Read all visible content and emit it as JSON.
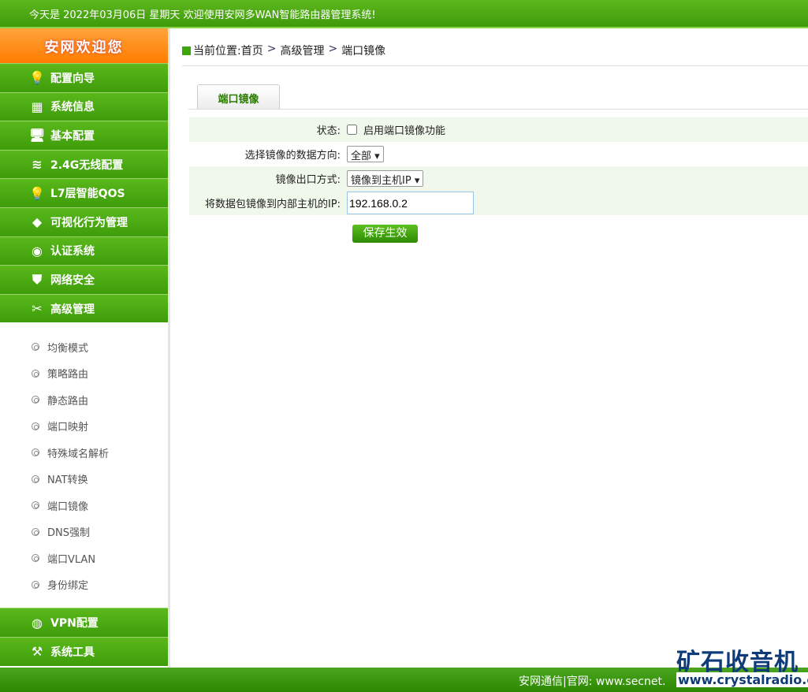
{
  "header": {
    "text": "今天是 2022年03月06日 星期天 欢迎使用安网多WAN智能路由器管理系统!"
  },
  "sidebar": {
    "welcome": "安网欢迎您",
    "items": [
      {
        "label": "配置向导",
        "icon": "lightbulb-icon"
      },
      {
        "label": "系统信息",
        "icon": "calendar-icon"
      },
      {
        "label": "基本配置",
        "icon": "monitor-icon"
      },
      {
        "label": "2.4G无线配置",
        "icon": "wifi-icon"
      },
      {
        "label": "L7层智能QOS",
        "icon": "lightbulb-icon"
      },
      {
        "label": "可视化行为管理",
        "icon": "warning-icon"
      },
      {
        "label": "认证系统",
        "icon": "medal-icon"
      },
      {
        "label": "网络安全",
        "icon": "shield-icon"
      },
      {
        "label": "高级管理",
        "icon": "tools-icon"
      }
    ],
    "subitems": [
      "均衡模式",
      "策略路由",
      "静态路由",
      "端口映射",
      "特殊域名解析",
      "NAT转换",
      "端口镜像",
      "DNS强制",
      "端口VLAN",
      "身份绑定"
    ],
    "bottom_items": [
      {
        "label": "VPN配置",
        "icon": "globe-icon"
      },
      {
        "label": "系统工具",
        "icon": "wrench-icon"
      }
    ]
  },
  "breadcrumb": {
    "prefix": "当前位置:",
    "items": [
      "首页",
      "高级管理",
      "端口镜像"
    ],
    "sep": ">"
  },
  "tab": "端口镜像",
  "form": {
    "status_label": "状态:",
    "status_checkbox": "启用端口镜像功能",
    "status_checked": false,
    "direction_label": "选择镜像的数据方向:",
    "direction_value": "全部",
    "output_label": "镜像出口方式:",
    "output_value": "镜像到主机IP",
    "ip_label": "将数据包镜像到内部主机的IP:",
    "ip_value": "192.168.0.2",
    "save": "保存生效"
  },
  "footer": {
    "text": "安网通信|官网: www.secnet."
  },
  "watermark": {
    "title": "矿石收音机",
    "url": "www.crystalradio.cn"
  },
  "colors": {
    "accent": "#3f9a0a",
    "welcome": "#ff7c00"
  }
}
